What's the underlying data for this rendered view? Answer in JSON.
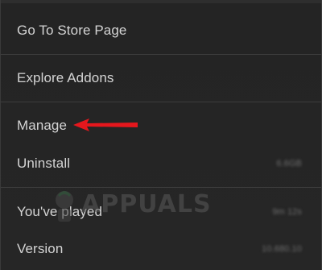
{
  "menu": {
    "items": [
      {
        "label": "Go To Store Page"
      },
      {
        "label": "Explore Addons"
      },
      {
        "label": "Manage"
      },
      {
        "label": "Uninstall",
        "value": "6.6GB"
      },
      {
        "label": "You've played",
        "value": "9m 12s"
      },
      {
        "label": "Version",
        "value": "10.680.10"
      }
    ]
  },
  "watermark": {
    "text": "APPUALS"
  },
  "colors": {
    "background": "#252525",
    "text": "#d4d4d4",
    "divider": "#3d3d3d",
    "arrow": "#e5171d"
  },
  "icons": {
    "annotation": "red-arrow-icon"
  }
}
